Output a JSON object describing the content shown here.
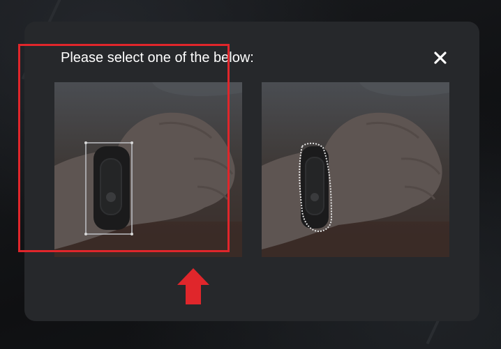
{
  "modal": {
    "title": "Please select one of the below:",
    "close_glyph": "✕",
    "close_icon": "close-icon"
  },
  "options": [
    {
      "name": "bounding-box-option",
      "icon": "bounding-box",
      "highlighted": true
    },
    {
      "name": "segmentation-outline-option",
      "icon": "dotted-outline",
      "highlighted": false
    }
  ],
  "annotation": {
    "arrow_icon": "arrow-up-icon",
    "highlight_color": "#e0262b"
  },
  "colors": {
    "modal_bg": "#26282b",
    "title_text": "#ffffff"
  }
}
